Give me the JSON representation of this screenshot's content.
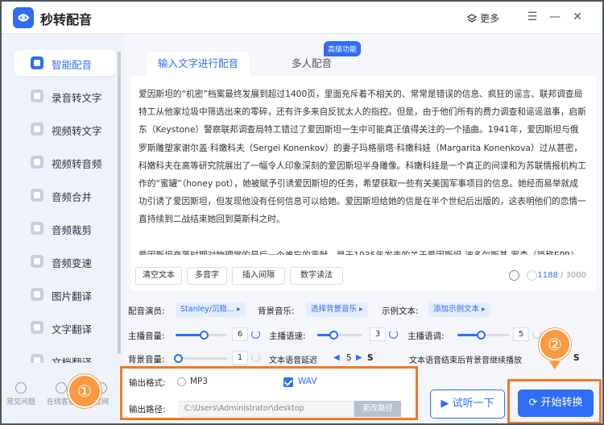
{
  "app": {
    "title": "秒转配音",
    "more": "更多",
    "colors": {
      "accent": "#2f6df6",
      "highlight": "#f07a2a",
      "badge_circle": "#f79a42"
    }
  },
  "sidebar": {
    "items": [
      {
        "label": "智能配音",
        "icon": "mic-icon",
        "active": true
      },
      {
        "label": "录音转文字",
        "icon": "record-icon"
      },
      {
        "label": "视频转文字",
        "icon": "video-text-icon"
      },
      {
        "label": "视频转音频",
        "icon": "video-audio-icon"
      },
      {
        "label": "音频合并",
        "icon": "merge-icon"
      },
      {
        "label": "音频裁剪",
        "icon": "scissors-icon"
      },
      {
        "label": "音频变速",
        "icon": "speed-icon"
      },
      {
        "label": "图片翻译",
        "icon": "image-translate-icon"
      },
      {
        "label": "文字翻译",
        "icon": "text-translate-icon"
      },
      {
        "label": "文档翻译",
        "icon": "doc-translate-icon"
      }
    ],
    "bottom": [
      {
        "label": "常见问题",
        "icon": "help-icon"
      },
      {
        "label": "在线客服",
        "icon": "chat-icon"
      },
      {
        "label": "官网",
        "icon": "globe-icon"
      }
    ]
  },
  "tabs": [
    {
      "label": "输入文字进行配音"
    },
    {
      "label": "多人配音"
    }
  ],
  "badge": "高级功能",
  "editor": {
    "paragraphs": [
      "爱因斯坦的“机密”档案最终发展到超过1400页，里面充斥着不相关的、常常是错误的信息、疯狂的谣言、联邦调查局特工从他家垃圾中筛选出来的零碎，还有许多来自反犹太人的指控。但是，由于他们所有的费力调查和谣谣滋事，启斯东（Keystone）警察联邦调查局特工错过了爱因斯坦一生中可能真正值得关注的一个插曲。1941年，爱因斯坦与俄罗斯雕塑家谢尔盖·科嫩科夫（Sergei Konenkov）的妻子玛格丽塔·科嫩科娃（Margarita Konenkova）过从甚密，科嫩科夫在高等研究院展出了一幅令人印象深刻的爱因斯坦半身雕像。科嫩科娃是一个真正的间谍和为苏联情报机构工作的“蜜罐”（honey pot），她被赋予引诱爱因斯坦的任务，希望获取一些有关美国军事项目的信息。她经而易举就成功引诱了爱因斯坦，但发现他没有任何信息可以给她。爱因斯坦给她的信是在半个世纪后出版的，这表明他们的恋情一直持续到二战结束她回到莫斯科之时。",
      "爱因斯坦衰落时期对物理学的最后一个难忘的贡献，是于1935年发表的关于爱因斯坦-波多尔斯基-罗森（简称EPR）佯谬"
    ],
    "count": "1188",
    "max": "/ 3000"
  },
  "tools": [
    "清空文本",
    "多音字",
    "插入间隔",
    "数字读法"
  ],
  "settings": {
    "anchor_label": "配音演员:",
    "anchor_value": "Stanley/沉稳...",
    "bgm_label": "背景音乐:",
    "bgm_value": "选择背景音乐",
    "sample_label": "示例文本:",
    "sample_value": "添加示例文本",
    "volume_label": "主播音量:",
    "volume_value": "6",
    "volume_level": 0.55,
    "speed_label": "主播语速:",
    "speed_value": "3",
    "speed_level": 0.35,
    "pitch_label": "主播语调:",
    "pitch_value": "5",
    "pitch_level": 0.45,
    "bg_volume_label": "背景音量:",
    "bg_volume_value": "1",
    "bg_volume_level": 0.05,
    "delay_label": "文本语音延迟",
    "delay_value": "5",
    "delay_unit": "S",
    "continue_label": "文本语音结束后背景音继续播放",
    "continue_unit": "S"
  },
  "output": {
    "format_label": "输出格式:",
    "mp3": "MP3",
    "wav": "WAV",
    "selected": "WAV",
    "path_label": "输出路径:",
    "path_value": "C:\\Users\\Administrator\\desktop",
    "path_button": "更改路径"
  },
  "actions": {
    "try": "试听一下",
    "start": "开始转换"
  },
  "annotations": {
    "one": "①",
    "two": "②"
  }
}
